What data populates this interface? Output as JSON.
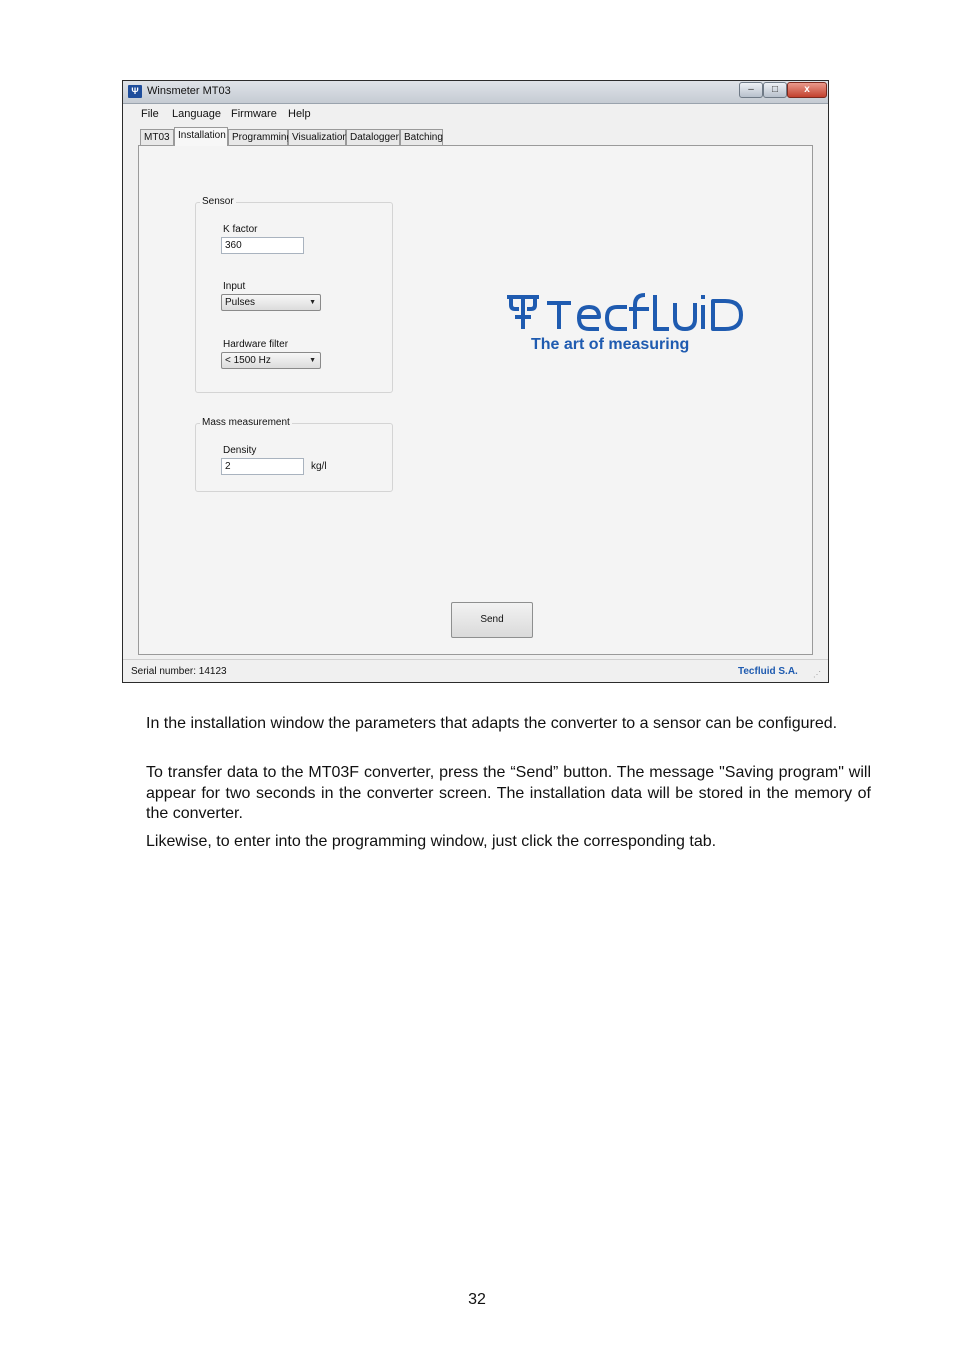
{
  "window": {
    "title": "Winsmeter MT03",
    "icon": "tecfluid-app-icon",
    "controls": {
      "minimize": "–",
      "maximize": "□",
      "close": "x"
    }
  },
  "menu": [
    "File",
    "Language",
    "Firmware",
    "Help"
  ],
  "tabs": [
    {
      "label": "MT03",
      "active": false
    },
    {
      "label": "Installation",
      "active": true
    },
    {
      "label": "Programming",
      "active": false
    },
    {
      "label": "Visualization",
      "active": false
    },
    {
      "label": "Datalogger",
      "active": false
    },
    {
      "label": "Batching",
      "active": false
    }
  ],
  "sensor": {
    "legend": "Sensor",
    "k_factor_label": "K factor",
    "k_factor_value": "360",
    "input_label": "Input",
    "input_value": "Pulses",
    "hw_filter_label": "Hardware filter",
    "hw_filter_value": "< 1500 Hz"
  },
  "mass": {
    "legend": "Mass measurement",
    "density_label": "Density",
    "density_value": "2",
    "density_unit": "kg/l"
  },
  "logo": {
    "brand": "TECFLUID",
    "tagline": "The art of measuring"
  },
  "send_label": "Send",
  "status": {
    "serial": "Serial number: 14123",
    "company": "Tecfluid S.A."
  },
  "colors": {
    "brand_blue": "#1f5bb0",
    "window_bg": "#f0f0f0"
  },
  "paragraphs": [
    "In the installation window the parameters that adapts the converter to a sensor can be configured.",
    "To transfer data to the MT03F converter, press the “Send” button. The message \"Saving program\" will appear for two seconds in the converter screen. The installation data will be stored in the memory of the converter.",
    "Likewise, to enter into the programming window, just click the corresponding tab."
  ],
  "page_number": "32"
}
